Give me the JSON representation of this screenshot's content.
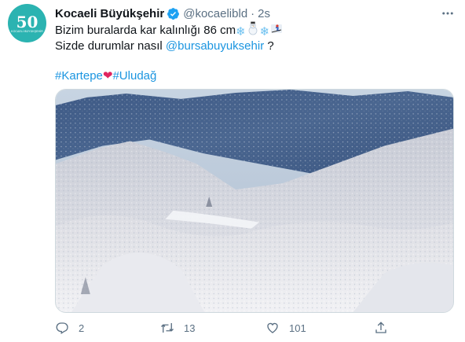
{
  "account": {
    "name": "Kocaeli Büyükşehir",
    "handle": "@kocaelibld",
    "separator": "·",
    "time": "2s",
    "avatar_number": "50",
    "avatar_text": "KOCAELİ BÜYÜKŞEHİR"
  },
  "tweet": {
    "line1_text": "Bizim buralarda kar kalınlığı 86 cm",
    "line2_text": "Sizde durumlar nasıl ",
    "line2_mention": "@bursabuyuksehir",
    "line2_suffix": " ?",
    "hashtag1": "#Kartepe",
    "hashtag2": "#Uludağ"
  },
  "icons": {
    "verified": "verified-badge-icon",
    "more": "more-icon",
    "snowflake": "snowflake-icon",
    "snowman": "snowman-icon",
    "skier": "skier-icon",
    "heart": "red-heart-icon",
    "reply": "reply-icon",
    "retweet": "retweet-icon",
    "like": "like-icon",
    "share": "share-icon"
  },
  "colors": {
    "link": "#1b95e0",
    "secondary_text": "#5b7083",
    "verified": "#1da1f2",
    "avatar_bg": "#2bb3b1"
  },
  "actions": {
    "reply_count": "2",
    "retweet_count": "13",
    "like_count": "101"
  }
}
